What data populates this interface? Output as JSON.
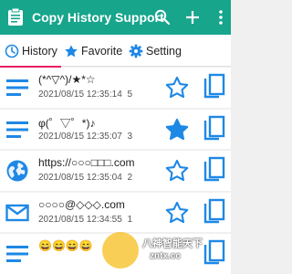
{
  "app": {
    "title": "Copy History Support"
  },
  "tabs": [
    {
      "label": "History",
      "icon": "clock-icon",
      "selected": true
    },
    {
      "label": "Favorite",
      "icon": "star-icon",
      "selected": false
    },
    {
      "label": "Setting",
      "icon": "gear-icon",
      "selected": false
    }
  ],
  "items": [
    {
      "type": "text-icon",
      "text": "(*^▽^)/★*☆",
      "date": "2021/08/15 12:35:14",
      "count": "5",
      "favorite": false
    },
    {
      "type": "text-icon",
      "text": "φ(゜▽゜*)♪",
      "date": "2021/08/15 12:35:07",
      "count": "3",
      "favorite": true
    },
    {
      "type": "globe-icon",
      "text": "https://○○○□□□.com",
      "date": "2021/08/15 12:35:04",
      "count": "2",
      "favorite": false
    },
    {
      "type": "mail-icon",
      "text": "○○○○@◇◇◇.com",
      "date": "2021/08/15 12:34:55",
      "count": "1",
      "favorite": false
    },
    {
      "type": "text-icon",
      "text": "😄😄😄😄",
      "date": "",
      "count": "",
      "favorite": false
    }
  ],
  "colors": {
    "accent": "#17a58c",
    "blue": "#1e88e5",
    "indicator": "#e91e63"
  },
  "watermark": {
    "line1": "八神智能天下",
    "line2": "zntx.cc"
  }
}
